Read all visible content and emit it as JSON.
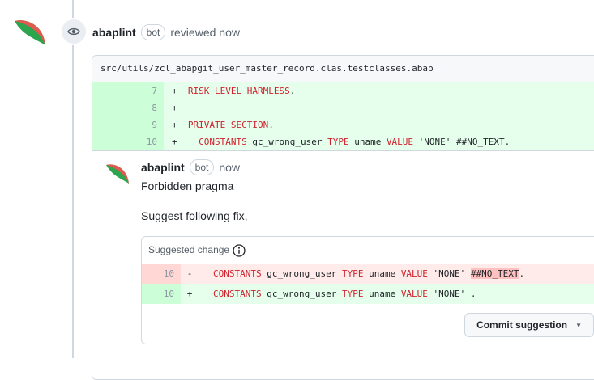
{
  "review": {
    "author": "abaplint",
    "badge": "bot",
    "action": "reviewed now"
  },
  "file": {
    "path": "src/utils/zcl_abapgit_user_master_record.clas.testclasses.abap",
    "lines": [
      {
        "num": "7",
        "sign": "+",
        "code": [
          {
            "t": "kw",
            "v": "RISK LEVEL HARMLESS"
          },
          {
            "t": "plain",
            "v": "."
          }
        ]
      },
      {
        "num": "8",
        "sign": "+",
        "code": []
      },
      {
        "num": "9",
        "sign": "+",
        "code": [
          {
            "t": "kw",
            "v": "PRIVATE SECTION"
          },
          {
            "t": "plain",
            "v": "."
          }
        ]
      },
      {
        "num": "10",
        "sign": "+",
        "code": [
          {
            "t": "plain",
            "v": "  "
          },
          {
            "t": "kw",
            "v": "CONSTANTS"
          },
          {
            "t": "plain",
            "v": " gc_wrong_user "
          },
          {
            "t": "kw",
            "v": "TYPE"
          },
          {
            "t": "plain",
            "v": " uname "
          },
          {
            "t": "kw",
            "v": "VALUE"
          },
          {
            "t": "plain",
            "v": " 'NONE' ##NO_TEXT."
          }
        ]
      }
    ]
  },
  "comment": {
    "author": "abaplint",
    "badge": "bot",
    "time": "now",
    "title": "Forbidden pragma",
    "body": "Suggest following fix,"
  },
  "suggestion": {
    "header": "Suggested change",
    "del_line": {
      "num": "10",
      "sign": "-",
      "code": [
        {
          "t": "kw",
          "v": "CONSTANTS"
        },
        {
          "t": "plain",
          "v": " gc_wrong_user "
        },
        {
          "t": "kw",
          "v": "TYPE"
        },
        {
          "t": "plain",
          "v": " uname "
        },
        {
          "t": "kw",
          "v": "VALUE"
        },
        {
          "t": "plain",
          "v": " 'NONE' "
        },
        {
          "t": "hl",
          "v": "##NO_TEXT"
        },
        {
          "t": "plain",
          "v": "."
        }
      ]
    },
    "add_line": {
      "num": "10",
      "sign": "+",
      "code": [
        {
          "t": "kw",
          "v": "CONSTANTS"
        },
        {
          "t": "plain",
          "v": " gc_wrong_user "
        },
        {
          "t": "kw",
          "v": "TYPE"
        },
        {
          "t": "plain",
          "v": " uname "
        },
        {
          "t": "kw",
          "v": "VALUE"
        },
        {
          "t": "plain",
          "v": " 'NONE' ."
        }
      ]
    },
    "commit_label": "Commit suggestion"
  },
  "colors": {
    "keyword": "#cf222e",
    "added_bg": "#e6ffec",
    "deleted_bg": "#ffebe9",
    "avatar_green": "#2da44e",
    "avatar_red": "#e05a4f"
  }
}
